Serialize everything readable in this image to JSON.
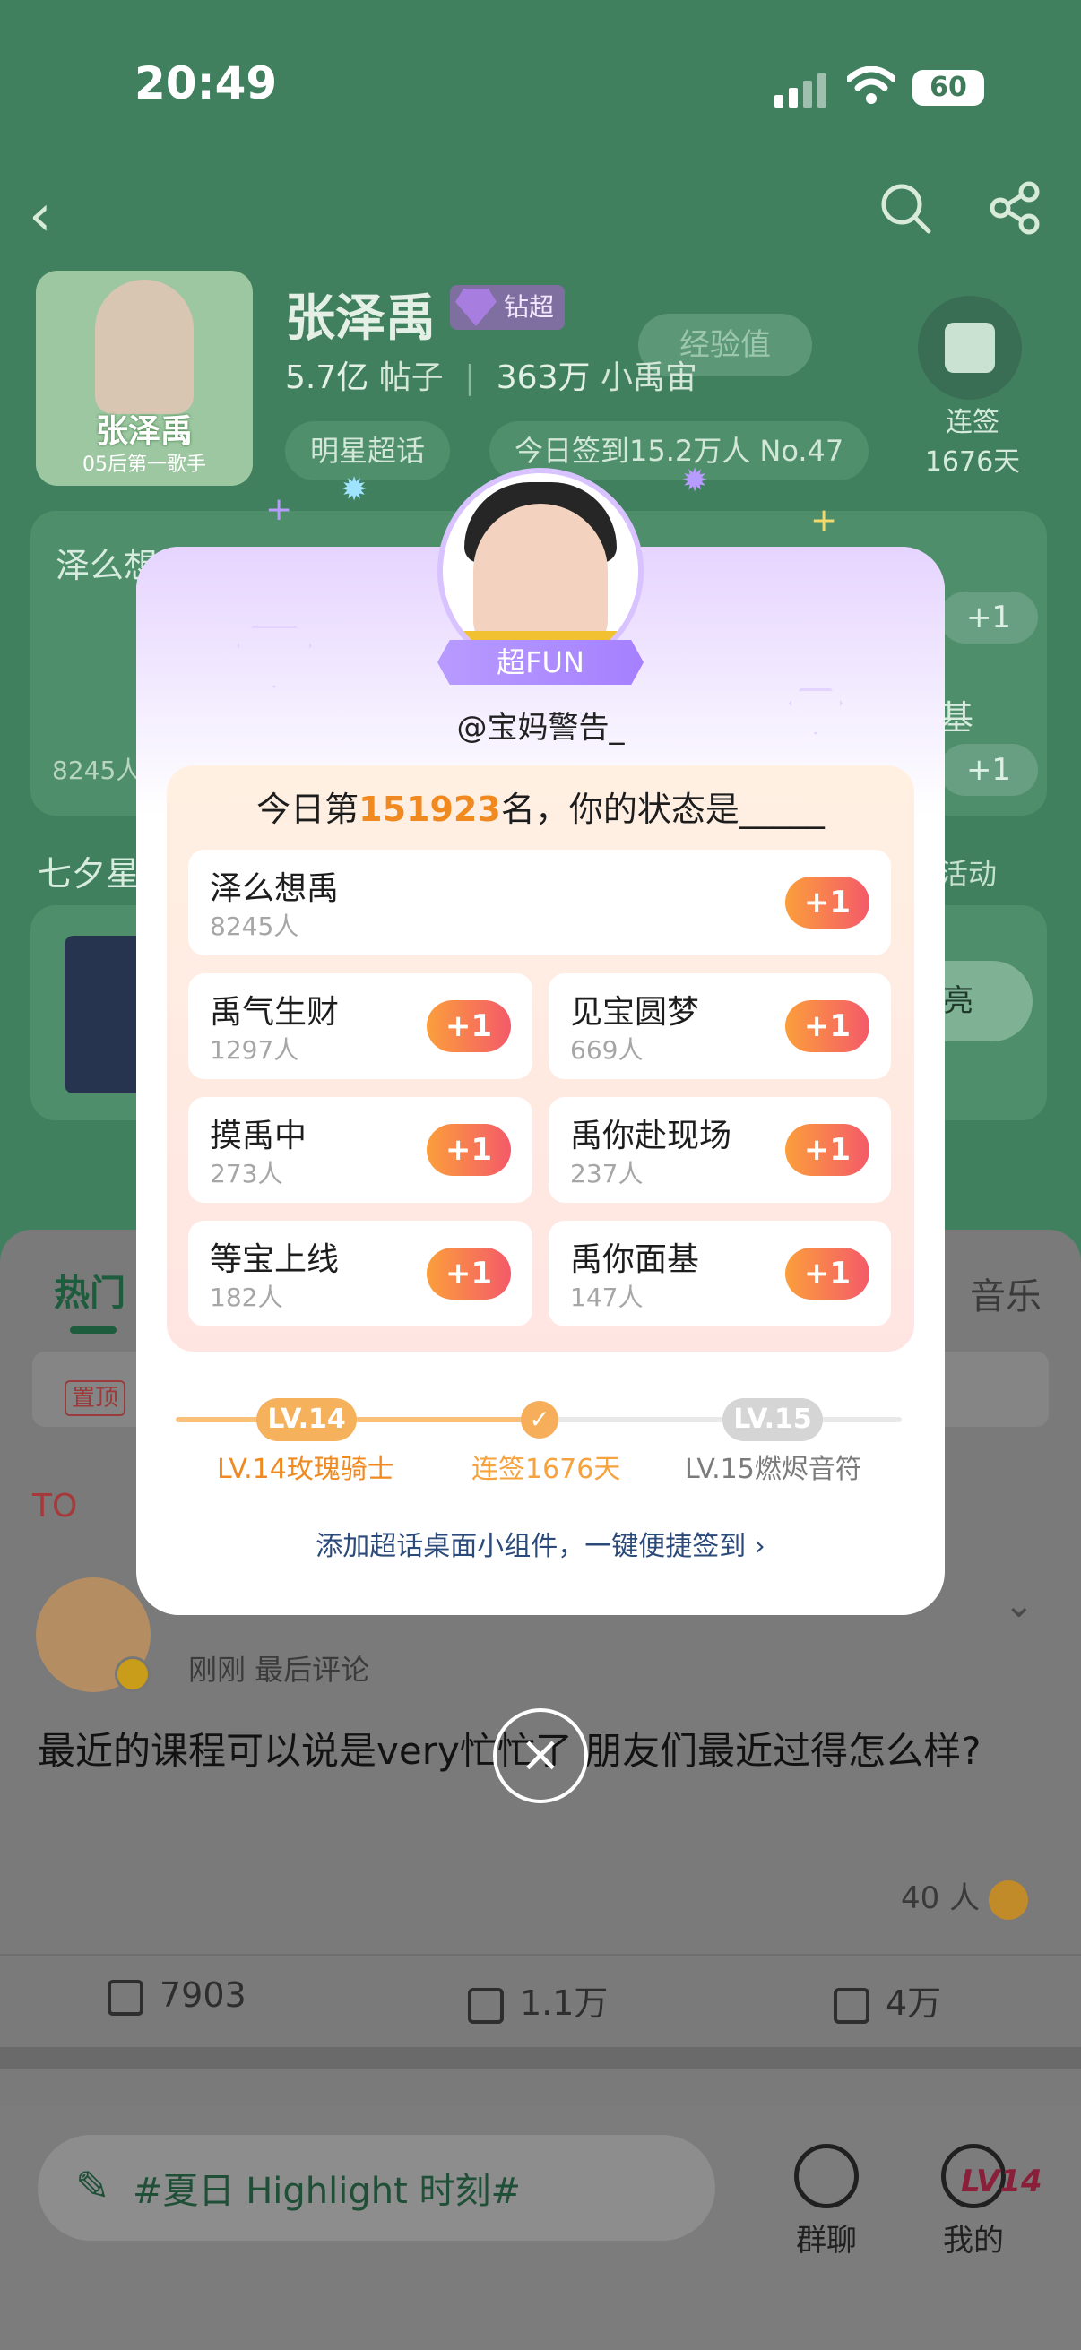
{
  "status_bar": {
    "time": "20:49",
    "battery": "60"
  },
  "header": {
    "star_name": "张泽禹",
    "badge": "钻超",
    "exp_label": "经验值",
    "posts_count": "5.7亿",
    "posts_label": "帖子",
    "members_count": "363万",
    "members_label": "小禹宙",
    "tag_super": "明星超话",
    "checkin_today": "今日签到15.2万人 No.47",
    "streak_label": "连签",
    "streak_days": "1676天",
    "cover_title": "张泽禹",
    "cover_subtitle": "05后第一歌手"
  },
  "background": {
    "hot_card_title": "泽么想",
    "hot_card_count": "8245人",
    "side_text": "基",
    "plus_label": "+1",
    "qixi": "七夕星",
    "qixi_right": "活动",
    "act_btn": "亮",
    "tab_hot": "热门",
    "tab_music": "音乐",
    "pin_tag": "置顶",
    "top_label": "TO",
    "post_meta": "刚刚  最后评论",
    "post_text": "最近的课程可以说是very忙忙了 朋友们最近过得怎么样?",
    "reactors": "40 人",
    "shares": "7903",
    "comments": "1.1万",
    "likes": "4万",
    "compose_placeholder": "#夏日 Highlight 时刻#",
    "nav_group": "群聊",
    "nav_mine": "我的",
    "nav_mine_level": "LV14"
  },
  "modal": {
    "ribbon": "超FUN",
    "handle": "@宝妈警告_",
    "question_prefix": "今日第",
    "rank": "151923",
    "question_suffix": "名，你的状态是_____",
    "options": [
      {
        "name": "泽么想禹",
        "count": "8245人",
        "action": "+1"
      },
      {
        "name": "禹气生财",
        "count": "1297人",
        "action": "+1"
      },
      {
        "name": "见宝圆梦",
        "count": "669人",
        "action": "+1"
      },
      {
        "name": "摸禹中",
        "count": "273人",
        "action": "+1"
      },
      {
        "name": "禹你赴现场",
        "count": "237人",
        "action": "+1"
      },
      {
        "name": "等宝上线",
        "count": "182人",
        "action": "+1"
      },
      {
        "name": "禹你面基",
        "count": "147人",
        "action": "+1"
      }
    ],
    "level_current": "LV.14",
    "level_next": "LV.15",
    "level_current_label": "LV.14玫瑰骑士",
    "level_progress_label": "连签1676天",
    "level_next_label": "LV.15燃烬音符",
    "widget_link": "添加超话桌面小组件，一键便捷签到",
    "close_icon": "×"
  },
  "colors": {
    "accent_orange": "#f08a20",
    "modal_purple": "#b89bff",
    "bg_green": "#41805e"
  }
}
